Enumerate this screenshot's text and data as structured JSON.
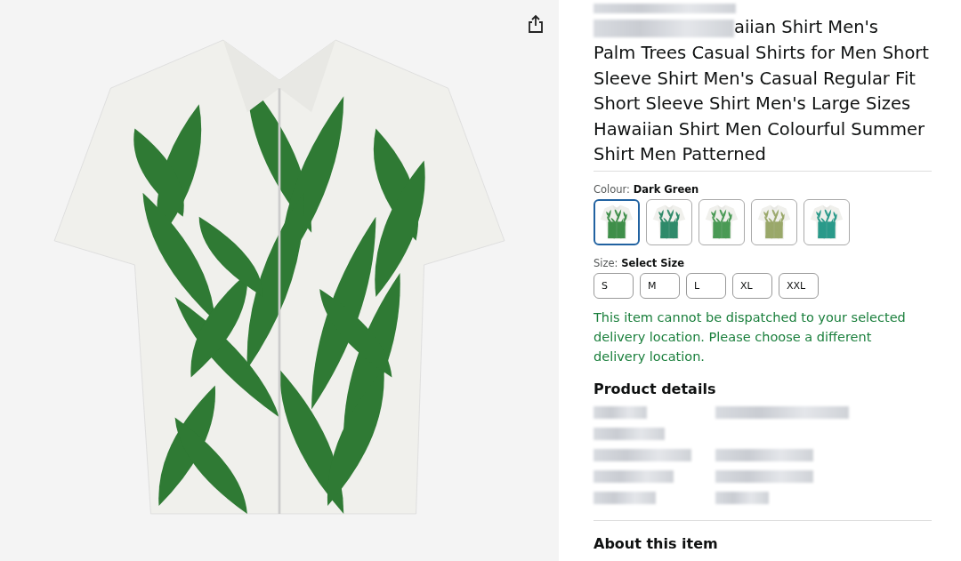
{
  "title_start": "aiian Shirt Men's",
  "title": "Palm Trees Casual Shirts for Men Short Sleeve Shirt Men's Casual Regular Fit Short Sleeve Shirt Men's Large Sizes Hawaiian Shirt Men Colourful Summer Shirt Men Patterned",
  "colour": {
    "label": "Colour:",
    "value": "Dark Green",
    "swatches": [
      {
        "selected": true,
        "color": "#3f8f4a"
      },
      {
        "selected": false,
        "color": "#2f8a6a"
      },
      {
        "selected": false,
        "color": "#4a9a55"
      },
      {
        "selected": false,
        "color": "#9aa86a"
      },
      {
        "selected": false,
        "color": "#2a9a8a"
      }
    ]
  },
  "size": {
    "label": "Size:",
    "value": "Select Size",
    "options": [
      {
        "label": "S",
        "selected": false
      },
      {
        "label": "M",
        "selected": false
      },
      {
        "label": "L",
        "selected": false
      },
      {
        "label": "XL",
        "selected": false
      },
      {
        "label": "XXL",
        "selected": false
      }
    ]
  },
  "dispatch_notice": "This item cannot be dispatched to your selected delivery location. Please choose a different delivery location.",
  "product_details": {
    "heading": "Product details"
  },
  "about": {
    "heading": "About this item"
  }
}
